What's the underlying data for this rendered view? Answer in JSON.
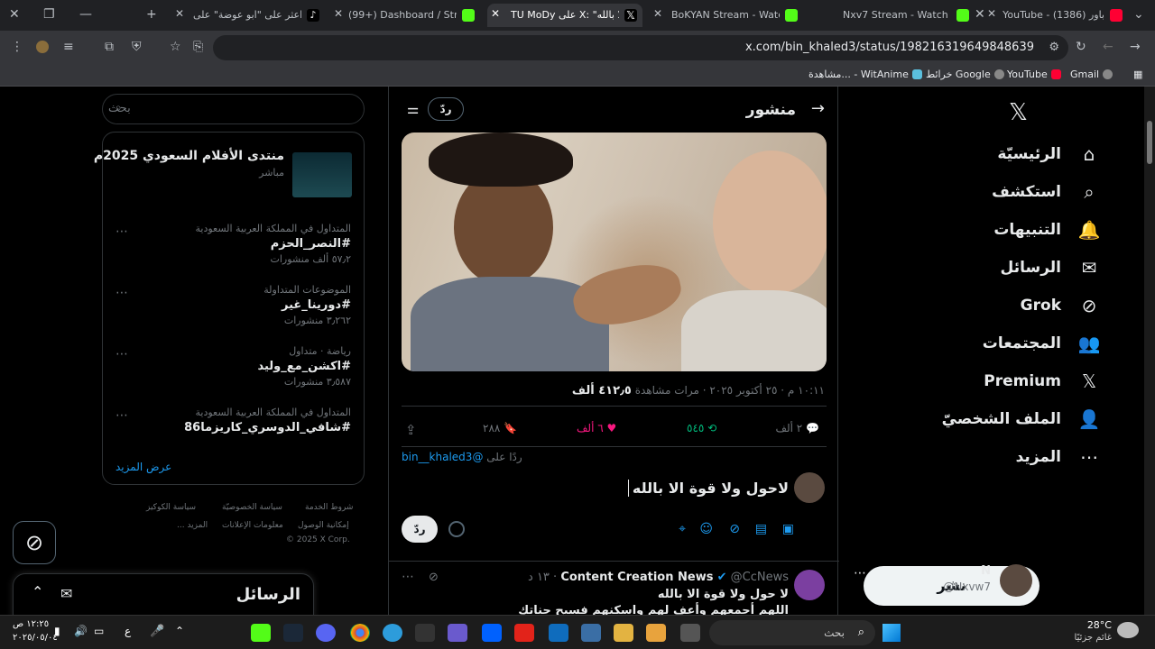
{
  "browser": {
    "tabs": [
      {
        "title": "YouTube - باور (1386)",
        "color": "#ff0033"
      },
      {
        "title": "Nxv7 Stream - Watch Live",
        "color": "#53fc18"
      },
      {
        "title": "BoKYAN Stream - Watch Li",
        "color": "#53fc18"
      },
      {
        "title": "TU MoDy على X: \"قوة الا بالله",
        "color": "#000000"
      },
      {
        "title": "(99+) Dashboard / Stream",
        "color": "#53fc18"
      },
      {
        "title": "اعثر على \"ابو عوضة\" على ok",
        "color": "#000000"
      }
    ],
    "url": "x.com/bin_khaled3/status/1982163196498486​39",
    "bookmarks": [
      "Gmail",
      "YouTube",
      "خرائط Google",
      "مشاهدة... - WitAnime"
    ]
  },
  "nav": {
    "items": [
      {
        "label": "الرئيسيّة",
        "icon": "home-icon",
        "glyph": "⌂"
      },
      {
        "label": "استكشف",
        "icon": "search-icon",
        "glyph": "⌕"
      },
      {
        "label": "التنبيهات",
        "icon": "bell-icon",
        "glyph": "🔔"
      },
      {
        "label": "الرسائل",
        "icon": "mail-icon",
        "glyph": "✉"
      },
      {
        "label": "Grok",
        "icon": "grok-icon",
        "glyph": "⊘"
      },
      {
        "label": "المجتمعات",
        "icon": "communities-icon",
        "glyph": "👥"
      },
      {
        "label": "Premium",
        "icon": "x-logo-icon",
        "glyph": "𝕏"
      },
      {
        "label": "الملف الشخصيّ",
        "icon": "profile-icon",
        "glyph": "👤"
      },
      {
        "label": "المزيد",
        "icon": "more-icon",
        "glyph": "⋯"
      }
    ],
    "post_button": "نشر",
    "account": {
      "name": "N",
      "handle": "@Nxvw7"
    }
  },
  "post": {
    "header_title": "منشور",
    "reply_label": "ردّ",
    "meta_time": "١٠:١١ م · ٢٥ أكتوبر ٢٠٢٥ · ",
    "views_count": "٤١٢٫٥ ألف",
    "views_label": "مرات مشاهدة",
    "stats": {
      "replies": "٢ ألف",
      "reposts": "٥٤٥",
      "likes": "٦ ألف",
      "bookmarks": "٢٨٨"
    },
    "replying_to_label": "ردًا على",
    "replying_to_handle": "@bin__khaled3",
    "compose_text": "لاحول ولا قوة الا بالله",
    "compose_reply_button": "ردّ"
  },
  "next_post": {
    "author": "Content Creation News",
    "handle": "@CcNews",
    "time": "١٣ د",
    "line1": "لا حول ولا قوة الا بالله",
    "line2": "اللهم أجمعهم وأعف لهم واسكنهم فسيح جناتك"
  },
  "sidebar": {
    "search_placeholder": "بحث",
    "featured": {
      "title": "منتدى الأفلام السعودي 2025م",
      "sub": "مباشر"
    },
    "trends": [
      {
        "meta": "المتداول في المملكة العربية السعودية",
        "tag": "#النصر_الحزم",
        "count": "٥٧٫٢ ألف منشورات"
      },
      {
        "meta": "الموضوعات المتداولة",
        "tag": "#دورينا_غير",
        "count": "٣٫٢٦٢ منشورات"
      },
      {
        "meta": "رياضة · متداول",
        "tag": "#اكشن_مع_وليد",
        "count": "٣٫٥٨٧ منشورات"
      },
      {
        "meta": "المتداول في المملكة العربية السعودية",
        "tag": "#شافي_الدوسري_كاريزما86",
        "count": ""
      }
    ],
    "show_more": "عرض المزيد",
    "footer": [
      "شروط الخدمة",
      "سياسة الخصوصيّة",
      "سياسة الكوكيز",
      "إمكانية الوصول",
      "معلومات الإعلانات",
      "... المزيد",
      "© 2025 X Corp."
    ],
    "messages_drawer": "الرسائل"
  },
  "taskbar": {
    "weather_temp": "28°C",
    "weather_desc": "غائم جزئيًا",
    "search": "بحث",
    "time": "١٢:٢٥ ص",
    "date": "٢٠٢٥/٠٥/٠٤",
    "lang": "ع"
  }
}
